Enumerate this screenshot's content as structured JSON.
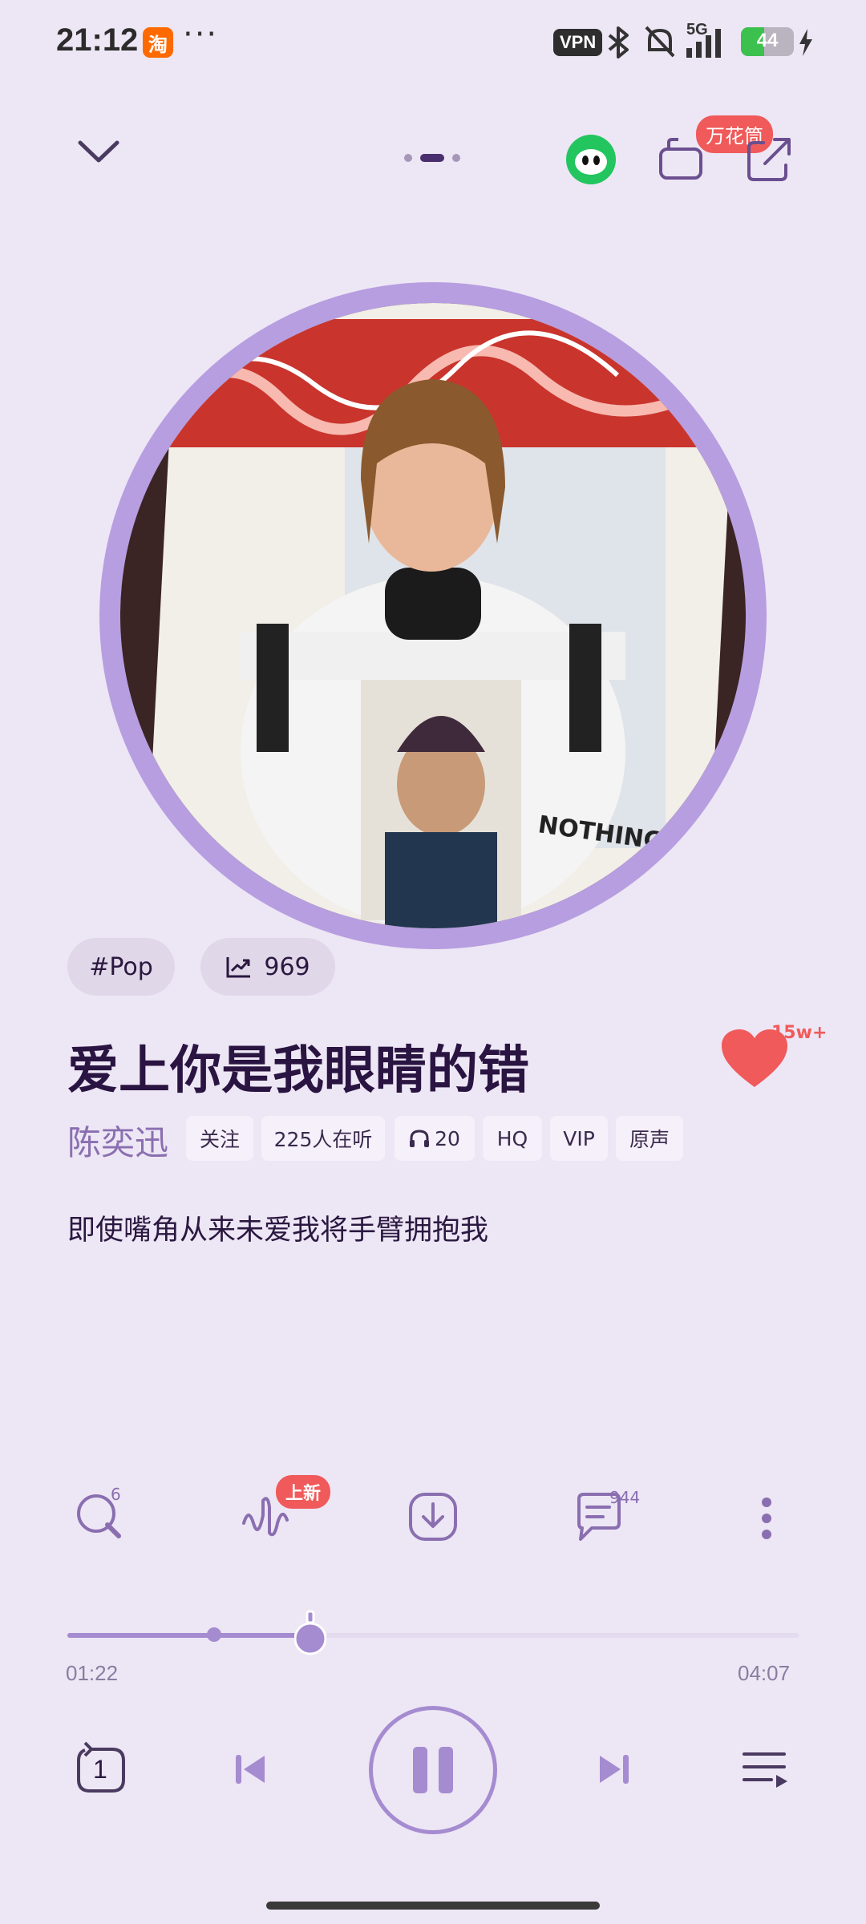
{
  "status_bar": {
    "time": "21:12",
    "taobao_icon_char": "淘",
    "more": "···",
    "vpn": "VPN",
    "network": "5G",
    "battery": "44"
  },
  "nav": {
    "kaleido_label": "万花筒"
  },
  "tags": {
    "genre": "#Pop",
    "trend_count": "969"
  },
  "song": {
    "title": "爱上你是我眼睛的错",
    "like_count": "15w+",
    "artist": "陈奕迅",
    "chips": [
      "关注",
      "225人在听",
      "20",
      "HQ",
      "VIP",
      "原声"
    ],
    "lyric": "即使嘴角从来未爱我将手臂拥抱我"
  },
  "actions": {
    "search_count": "6",
    "new_badge": "上新",
    "comment_count": "944"
  },
  "progress": {
    "current": "01:22",
    "total": "04:07",
    "fraction": 0.332
  },
  "player": {
    "repeat_count": "1"
  },
  "colors": {
    "background": "#ede6f5",
    "accent": "#a58bd0",
    "like": "#f05a5a"
  }
}
